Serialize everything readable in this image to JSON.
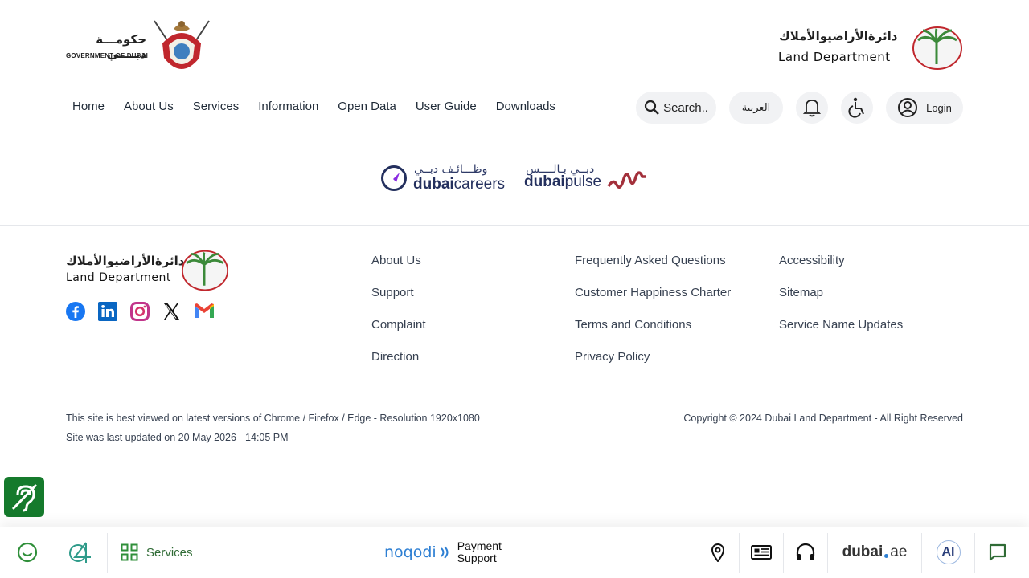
{
  "header": {
    "gov_logo": {
      "arabic": "حكومـــة دبــــي",
      "english": "GOVERNMENT OF DUBAI"
    },
    "dld_logo": {
      "arabic": "دائرةالأراضيوالأملاك",
      "english": "Land Department"
    },
    "nav": [
      "Home",
      "About Us",
      "Services",
      "Information",
      "Open Data",
      "User Guide",
      "Downloads"
    ],
    "search_label": "Search..",
    "language_label": "العربية",
    "login_label": "Login"
  },
  "partners": [
    {
      "arabic": "وظـــائـف دبــي",
      "name_bold": "dubai",
      "name_light": "careers"
    },
    {
      "arabic": "دبــي بـالــــس",
      "name_bold": "dubai",
      "name_light": "pulse"
    }
  ],
  "footer": {
    "logo": {
      "arabic": "دائرةالأراضيوالأملاك",
      "english": "Land Department"
    },
    "social": [
      "facebook-icon",
      "linkedin-icon",
      "instagram-icon",
      "x-icon",
      "gmail-icon"
    ],
    "col1": [
      "About Us",
      "Support",
      "Complaint",
      "Direction"
    ],
    "col2": [
      "Frequently Asked Questions",
      "Customer Happiness Charter",
      "Terms and Conditions",
      "Privacy Policy"
    ],
    "col3": [
      "Accessibility",
      "Sitemap",
      "Service Name Updates"
    ],
    "browser_note": "This site is best viewed on latest versions of Chrome / Firefox / Edge - Resolution 1920x1080",
    "last_updated": "Site was last updated on 20 May 2026 - 14:05 PM",
    "copyright": "Copyright © 2024 Dubai Land Department - All Right Reserved"
  },
  "bottom_bar": {
    "services_label": "Services",
    "noqodi_label": "noqodi",
    "payment_line1": "Payment",
    "payment_line2": "Support",
    "dubai_ae_bold": "dubai",
    "dubai_ae_light": "ae",
    "ai_label": "AI"
  },
  "colors": {
    "accent_green": "#2f8f3a",
    "brand_red": "#c0272d",
    "noqodi_blue": "#2d7fd3",
    "hearing_green": "#157a2c"
  }
}
